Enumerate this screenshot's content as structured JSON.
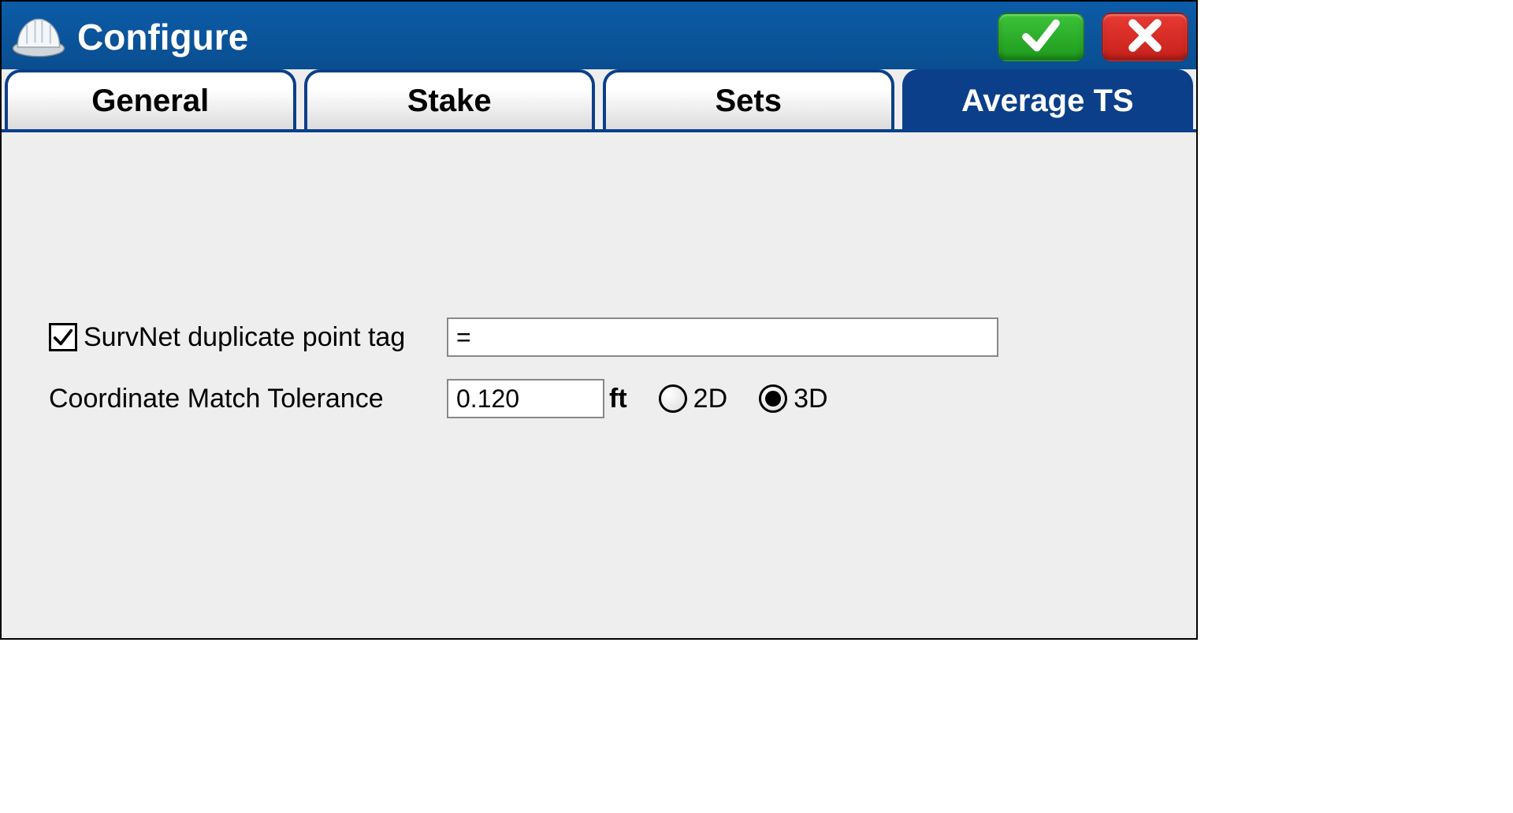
{
  "header": {
    "title": "Configure"
  },
  "tabs": [
    {
      "label": "General",
      "active": false
    },
    {
      "label": "Stake",
      "active": false
    },
    {
      "label": "Sets",
      "active": false
    },
    {
      "label": "Average TS",
      "active": true
    }
  ],
  "form": {
    "survnet": {
      "checkbox_label": "SurvNet duplicate point tag",
      "checked": true,
      "tag_value": "="
    },
    "tolerance": {
      "label": "Coordinate Match Tolerance",
      "value": "0.120",
      "unit": "ft",
      "mode_2d_label": "2D",
      "mode_3d_label": "3D",
      "mode_selected": "3D"
    }
  }
}
